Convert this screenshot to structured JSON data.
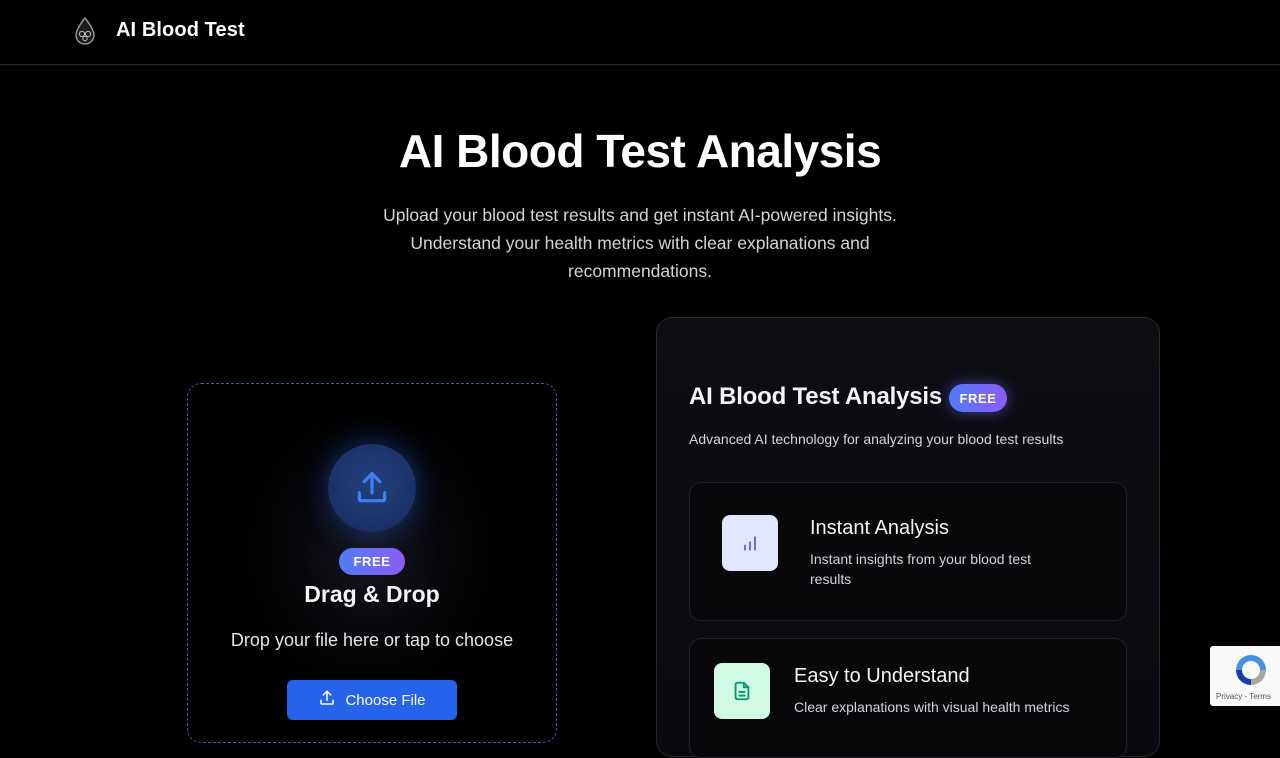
{
  "header": {
    "brand": "AI Blood Test",
    "logo_icon": "blood-drop-logo-icon"
  },
  "hero": {
    "title": "AI Blood Test Analysis",
    "subtitle": "Upload your blood test results and get instant AI-powered insights. Understand your health metrics with clear explanations and recommendations."
  },
  "upload": {
    "icon": "upload-icon",
    "badge": "FREE",
    "title": "Drag & Drop",
    "hint": "Drop your file here or tap to choose",
    "button_label": "Choose File",
    "button_icon": "upload-icon"
  },
  "info": {
    "title": "AI Blood Test Analysis",
    "badge": "FREE",
    "subtitle": "Advanced AI technology for analyzing your blood test results",
    "features": [
      {
        "icon": "bar-chart-icon",
        "title": "Instant Analysis",
        "description": "Instant insights from your blood test results"
      },
      {
        "icon": "document-icon",
        "title": "Easy to Understand",
        "description": "Clear explanations with visual health metrics"
      }
    ]
  },
  "recaptcha": {
    "links": "Privacy - Terms"
  },
  "colors": {
    "background": "#000000",
    "accent_blue": "#2563eb",
    "badge_gradient_start": "#4f7cf7",
    "badge_gradient_end": "#8b5cf6",
    "dashed_border": "#3b5cb8"
  }
}
